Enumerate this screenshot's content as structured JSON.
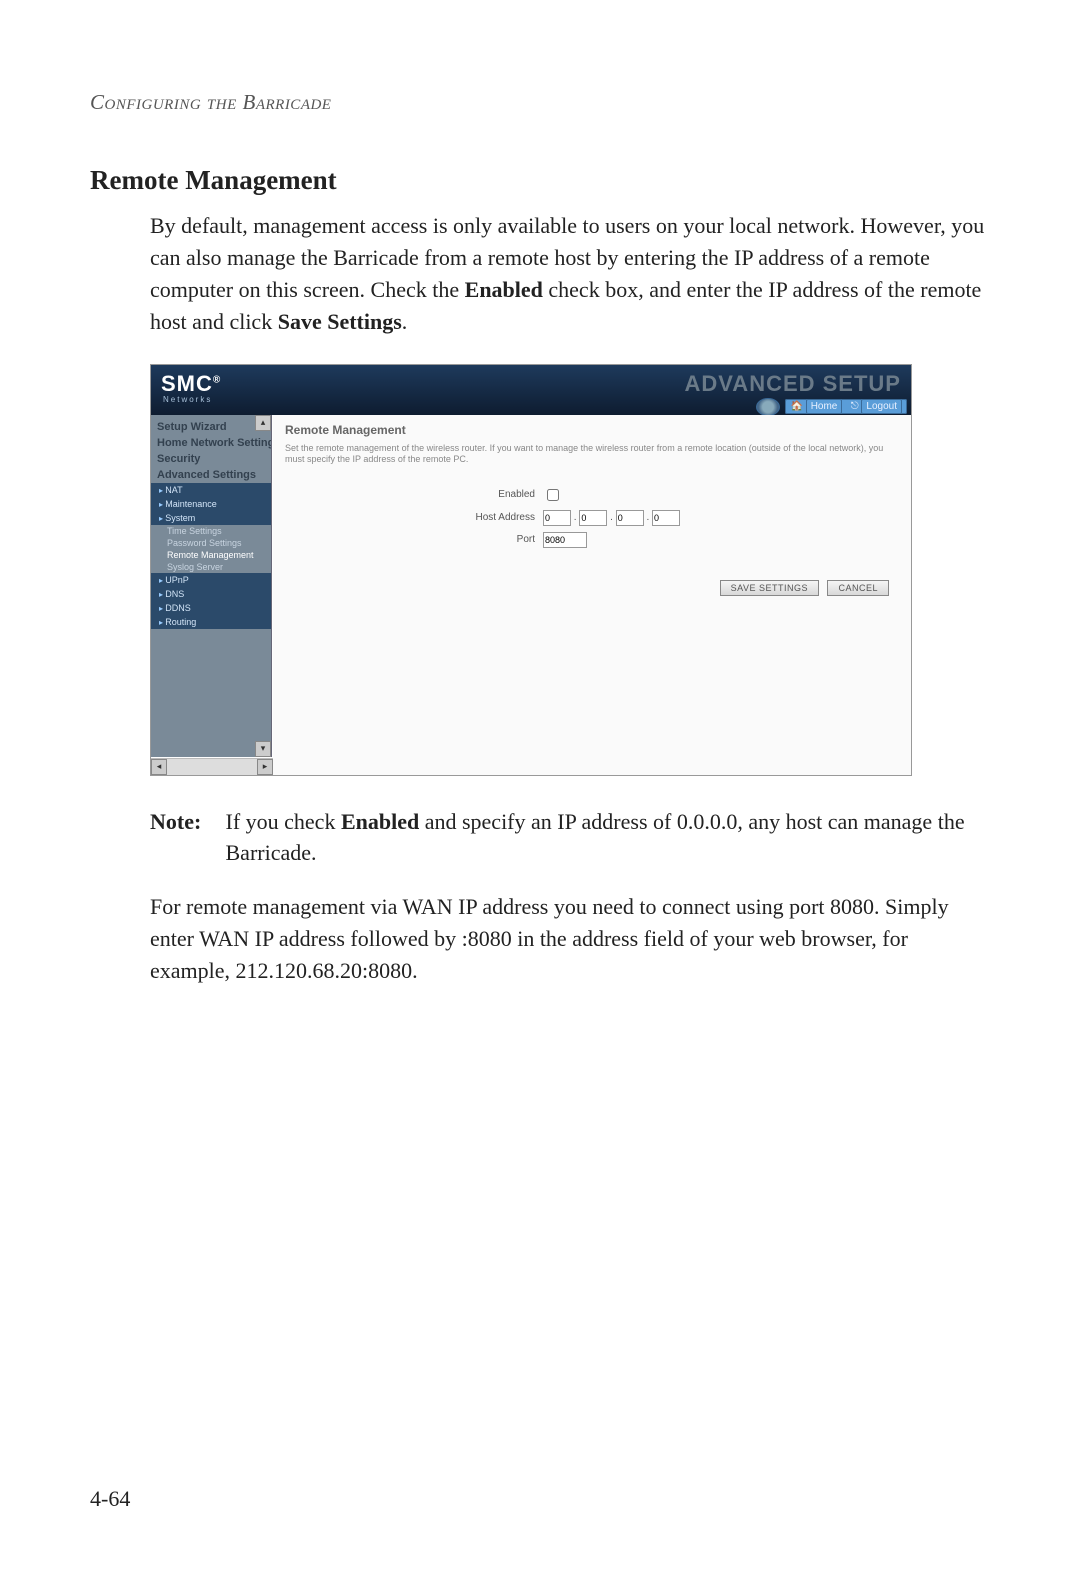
{
  "header": "Configuring the Barricade",
  "section_title": "Remote Management",
  "intro": {
    "t1": "By default, management access is only available to users on your local network. However, you can also manage the Barricade from a remote host by entering the IP address of a remote computer on this screen. Check the ",
    "b1": "Enabled",
    "t2": " check box, and enter the IP address of the remote host and click ",
    "b2": "Save Settings",
    "t3": "."
  },
  "shot": {
    "logo": "SMC",
    "logo_sub": "Networks",
    "advanced": "ADVANCED SETUP",
    "home": "Home",
    "logout": "Logout",
    "sidebar": {
      "groups": {
        "g0": "Setup Wizard",
        "g1": "Home Network Settings",
        "g2": "Security",
        "g3": "Advanced Settings"
      },
      "blue": {
        "b0": "NAT",
        "b1": "Maintenance",
        "b2": "System",
        "b3": "UPnP",
        "b4": "DNS",
        "b5": "DDNS",
        "b6": "Routing"
      },
      "subs": {
        "s0": "Time Settings",
        "s1": "Password Settings",
        "s2": "Remote Management",
        "s3": "Syslog Server"
      }
    },
    "content": {
      "title": "Remote Management",
      "desc": "Set the remote management of the wireless router. If you want to manage the wireless router from a remote location (outside of the local network), you must specify the IP address of the remote PC.",
      "labels": {
        "enabled": "Enabled",
        "host": "Host Address",
        "port": "Port"
      },
      "ip": {
        "a": "0",
        "b": "0",
        "c": "0",
        "d": "0"
      },
      "port": "8080",
      "buttons": {
        "save": "SAVE SETTINGS",
        "cancel": "CANCEL"
      }
    }
  },
  "note": {
    "label": "Note:",
    "t1": "If you check ",
    "b1": "Enabled",
    "t2": " and specify an IP address of 0.0.0.0, any host can manage the Barricade."
  },
  "para2": "For remote management via WAN IP address you need to connect using port 8080. Simply enter WAN IP address followed by :8080 in the address field of your web browser, for example, 212.120.68.20:8080.",
  "page_number": "4-64"
}
